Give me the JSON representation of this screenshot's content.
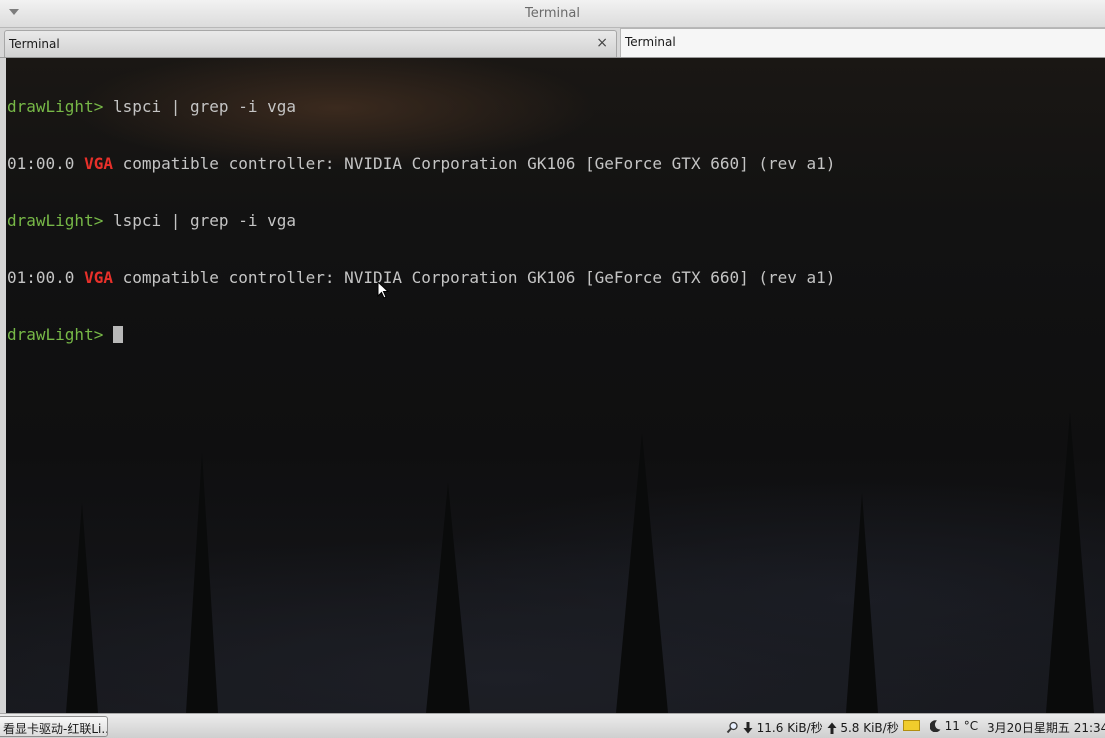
{
  "window": {
    "title": "Terminal"
  },
  "tabs": [
    {
      "label": "Terminal",
      "close": "×"
    },
    {
      "label": "Terminal"
    }
  ],
  "terminal": {
    "lines": [
      {
        "prompt": "drawLight>",
        "command": " lspci | grep -i vga"
      },
      {
        "pre": "01:00.0 ",
        "highlight": "VGA",
        "post": " compatible controller: NVIDIA Corporation GK106 [GeForce GTX 660] (rev a1)"
      },
      {
        "prompt": "drawLight>",
        "command": " lspci | grep -i vga"
      },
      {
        "pre": "01:00.0 ",
        "highlight": "VGA",
        "post": " compatible controller: NVIDIA Corporation GK106 [GeForce GTX 660] (rev a1)"
      },
      {
        "prompt": "drawLight>",
        "command": " "
      }
    ],
    "colors": {
      "prompt": "#77b847",
      "highlight": "#e8302a",
      "text": "#c4c4c4"
    }
  },
  "panel": {
    "task": "看显卡驱动-红联Li...",
    "net_down": "11.6 KiB/秒",
    "net_up": "5.8 KiB/秒",
    "temperature": "11 °C",
    "clock": "3月20日星期五 21:34",
    "icons": [
      "magnifier-icon",
      "down-arrow-icon",
      "up-arrow-icon",
      "folder-icon",
      "moon-icon"
    ]
  }
}
